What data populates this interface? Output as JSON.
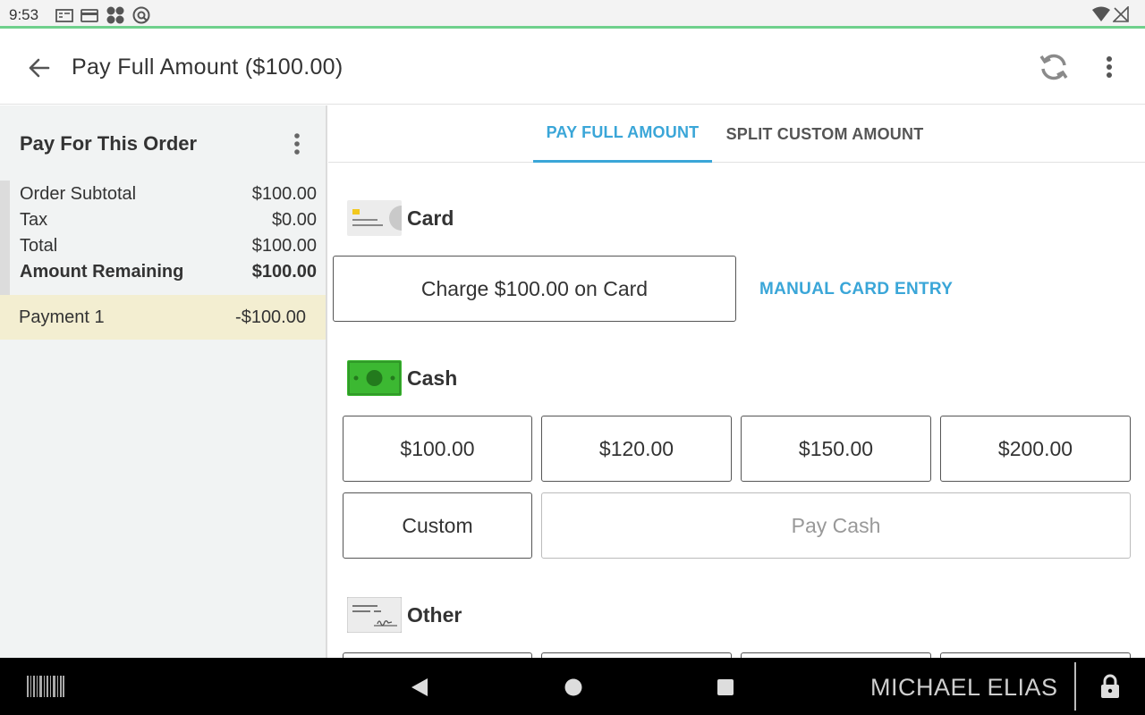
{
  "status_bar": {
    "time": "9:53",
    "accent_color": "#6fd08c"
  },
  "app_bar": {
    "title": "Pay Full Amount ($100.00)",
    "icons": [
      "back-arrow-icon",
      "refresh-icon",
      "more-vert-icon"
    ]
  },
  "order": {
    "title": "Pay For This Order",
    "summary": [
      {
        "label": "Order Subtotal",
        "value": "$100.00",
        "bold": false
      },
      {
        "label": "Tax",
        "value": "$0.00",
        "bold": false
      },
      {
        "label": "Total",
        "value": "$100.00",
        "bold": false
      },
      {
        "label": "Amount Remaining",
        "value": "$100.00",
        "bold": true
      }
    ],
    "payments": [
      {
        "label": "Payment 1",
        "value": "-$100.00"
      }
    ]
  },
  "tabs": [
    {
      "label": "PAY FULL AMOUNT",
      "active": true
    },
    {
      "label": "SPLIT CUSTOM AMOUNT",
      "active": false
    }
  ],
  "card": {
    "label": "Card",
    "charge_button": "Charge $100.00 on Card",
    "manual_entry": "MANUAL CARD ENTRY"
  },
  "cash": {
    "label": "Cash",
    "amounts": [
      "$100.00",
      "$120.00",
      "$150.00",
      "$200.00"
    ],
    "custom_button": "Custom",
    "pay_button": "Pay Cash"
  },
  "other": {
    "label": "Other"
  },
  "nav_bar": {
    "user_name": "MICHAEL ELIAS"
  },
  "colors": {
    "accent": "#3aa6d8",
    "payment_highlight": "#f3eed1",
    "cash_green": "#3cb832"
  }
}
